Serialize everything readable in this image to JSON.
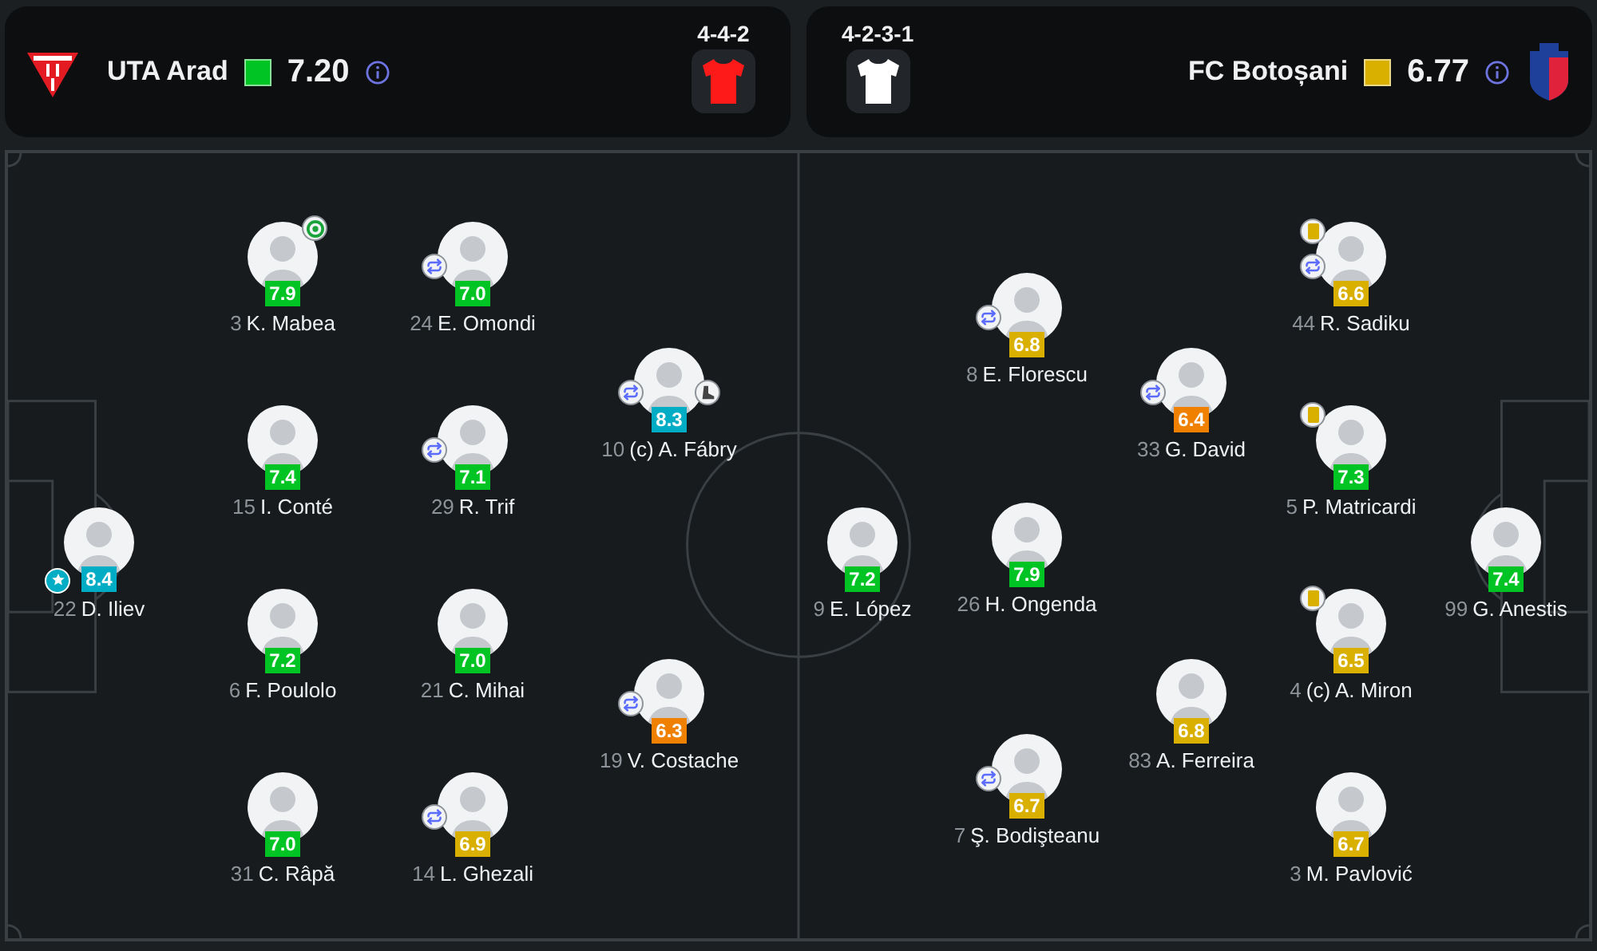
{
  "teams": [
    {
      "name": "UTA Arad",
      "rating": {
        "value": "7.20",
        "color": "#00c424"
      },
      "formation": "4-4-2",
      "shirt": {
        "color": "#ff1a1a"
      },
      "lines": [
        {
          "players": [
            {
              "number": "22",
              "name": "D. Iliev",
              "rating": "8.4",
              "color": "#00adc4",
              "events": [
                {
                  "kind": "motm"
                }
              ]
            }
          ]
        },
        {
          "players": [
            {
              "number": "3",
              "name": "K. Mabea",
              "rating": "7.9",
              "color": "#00c424",
              "events": [
                {
                  "kind": "goal"
                }
              ]
            },
            {
              "number": "15",
              "name": "I. Conté",
              "rating": "7.4",
              "color": "#00c424"
            },
            {
              "number": "6",
              "name": "F. Poulolo",
              "rating": "7.2",
              "color": "#00c424"
            },
            {
              "number": "31",
              "name": "C. Râpă",
              "rating": "7.0",
              "color": "#00c424"
            }
          ]
        },
        {
          "players": [
            {
              "number": "24",
              "name": "E. Omondi",
              "rating": "7.0",
              "color": "#00c424",
              "events": [
                {
                  "kind": "substitution"
                }
              ]
            },
            {
              "number": "29",
              "name": "R. Trif",
              "rating": "7.1",
              "color": "#00c424",
              "events": [
                {
                  "kind": "substitution"
                }
              ]
            },
            {
              "number": "21",
              "name": "C. Mihai",
              "rating": "7.0",
              "color": "#00c424"
            },
            {
              "number": "14",
              "name": "L. Ghezali",
              "rating": "6.9",
              "color": "#d9af00",
              "events": [
                {
                  "kind": "substitution"
                }
              ]
            }
          ]
        },
        {
          "players": [
            {
              "number": "10",
              "name": "(c) A. Fábry",
              "rating": "8.3",
              "color": "#00adc4",
              "events": [
                {
                  "kind": "substitution"
                },
                {
                  "kind": "assist"
                }
              ]
            },
            {
              "number": "19",
              "name": "V. Costache",
              "rating": "6.3",
              "color": "#f08000",
              "events": [
                {
                  "kind": "substitution"
                }
              ]
            }
          ]
        }
      ]
    },
    {
      "name": "FC Botoșani",
      "rating": {
        "value": "6.77",
        "color": "#d9af00"
      },
      "formation": "4-2-3-1",
      "shirt": {
        "color": "#ffffff"
      },
      "lines": [
        {
          "players": [
            {
              "number": "9",
              "name": "E. López",
              "rating": "7.2",
              "color": "#00c424"
            }
          ]
        },
        {
          "players": [
            {
              "number": "8",
              "name": "E. Florescu",
              "rating": "6.8",
              "color": "#d9af00",
              "events": [
                {
                  "kind": "substitution"
                }
              ]
            },
            {
              "number": "26",
              "name": "H. Ongenda",
              "rating": "7.9",
              "color": "#00c424"
            },
            {
              "number": "7",
              "name": "Ş. Bodişteanu",
              "rating": "6.7",
              "color": "#d9af00",
              "events": [
                {
                  "kind": "substitution"
                }
              ]
            }
          ]
        },
        {
          "players": [
            {
              "number": "33",
              "name": "G. David",
              "rating": "6.4",
              "color": "#f08000",
              "events": [
                {
                  "kind": "substitution"
                }
              ]
            },
            {
              "number": "83",
              "name": "A. Ferreira",
              "rating": "6.8",
              "color": "#d9af00"
            }
          ]
        },
        {
          "players": [
            {
              "number": "44",
              "name": "R. Sadiku",
              "rating": "6.6",
              "color": "#d9af00",
              "events": [
                {
                  "kind": "yellow_card"
                },
                {
                  "kind": "substitution"
                }
              ]
            },
            {
              "number": "5",
              "name": "P. Matricardi",
              "rating": "7.3",
              "color": "#00c424",
              "events": [
                {
                  "kind": "yellow_card"
                }
              ]
            },
            {
              "number": "4",
              "name": "(c) A. Miron",
              "rating": "6.5",
              "color": "#d9af00",
              "events": [
                {
                  "kind": "yellow_card"
                }
              ]
            },
            {
              "number": "3",
              "name": "M. Pavlović",
              "rating": "6.7",
              "color": "#d9af00"
            }
          ]
        },
        {
          "players": [
            {
              "number": "99",
              "name": "G. Anestis",
              "rating": "7.4",
              "color": "#00c424"
            }
          ]
        }
      ]
    }
  ]
}
